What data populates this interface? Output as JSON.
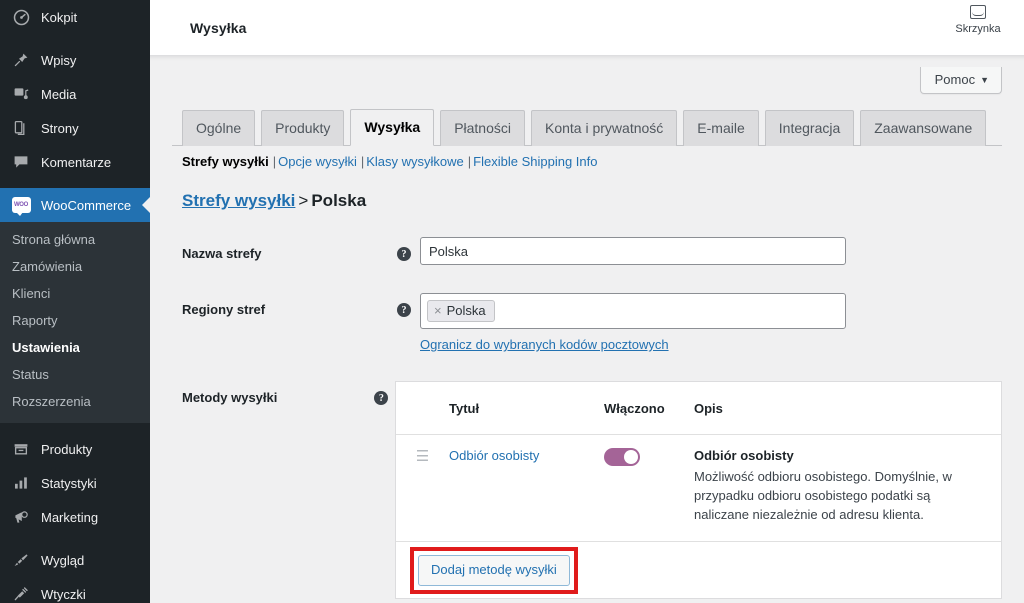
{
  "adminbar": {
    "site_title": "Wysyłka",
    "inbox_label": "Skrzynka",
    "inbox_icon": "inbox-icon"
  },
  "sidebar": {
    "items": [
      {
        "label": "Kokpit",
        "icon": "dashboard-icon",
        "current": false
      },
      {
        "label": "Wpisy",
        "icon": "pin-icon",
        "current": false
      },
      {
        "label": "Media",
        "icon": "media-icon",
        "current": false
      },
      {
        "label": "Strony",
        "icon": "pages-icon",
        "current": false
      },
      {
        "label": "Komentarze",
        "icon": "comment-icon",
        "current": false
      },
      {
        "label": "WooCommerce",
        "icon": "woocommerce-icon",
        "current": true
      },
      {
        "label": "Produkty",
        "icon": "products-box-icon",
        "current": false
      },
      {
        "label": "Statystyki",
        "icon": "bar-chart-icon",
        "current": false
      },
      {
        "label": "Marketing",
        "icon": "megaphone-icon",
        "current": false
      },
      {
        "label": "Wygląd",
        "icon": "paintbrush-icon",
        "current": false
      },
      {
        "label": "Wtyczki",
        "icon": "plug-icon",
        "current": false
      }
    ],
    "woo_submenu": [
      {
        "label": "Strona główna",
        "current": false
      },
      {
        "label": "Zamówienia",
        "current": false
      },
      {
        "label": "Klienci",
        "current": false
      },
      {
        "label": "Raporty",
        "current": false
      },
      {
        "label": "Ustawienia",
        "current": true
      },
      {
        "label": "Status",
        "current": false
      },
      {
        "label": "Rozszerzenia",
        "current": false
      }
    ],
    "woo_badge_text": "WOO"
  },
  "help": {
    "label": "Pomoc",
    "caret": "▼"
  },
  "tabs": [
    {
      "label": "Ogólne",
      "active": false
    },
    {
      "label": "Produkty",
      "active": false
    },
    {
      "label": "Wysyłka",
      "active": true
    },
    {
      "label": "Płatności",
      "active": false
    },
    {
      "label": "Konta i prywatność",
      "active": false
    },
    {
      "label": "E-maile",
      "active": false
    },
    {
      "label": "Integracja",
      "active": false
    },
    {
      "label": "Zaawansowane",
      "active": false
    }
  ],
  "subtabs": [
    {
      "label": "Strefy wysyłki",
      "current": true
    },
    {
      "label": "Opcje wysyłki",
      "current": false
    },
    {
      "label": "Klasy wysyłkowe",
      "current": false
    },
    {
      "label": "Flexible Shipping Info",
      "current": false
    }
  ],
  "breadcrumb": {
    "parent": "Strefy wysyłki",
    "separator": ">",
    "current": "Polska"
  },
  "form": {
    "zone_name": {
      "label": "Nazwa strefy",
      "value": "Polska",
      "placeholder": "Nazwa strefy"
    },
    "zone_regions": {
      "label": "Regiony stref",
      "chip": "Polska",
      "chip_remove": "×",
      "postcode_link": "Ogranicz do wybranych kodów pocztowych"
    },
    "shipping_methods": {
      "label": "Metody wysyłki"
    },
    "help_glyph": "?"
  },
  "methods_table": {
    "columns": [
      "",
      "Tytuł",
      "Włączono",
      "Opis"
    ],
    "rows": [
      {
        "sort_handle": "☰",
        "title": "Odbiór osobisty",
        "enabled": true,
        "desc_title": "Odbiór osobisty",
        "desc_text": "Możliwość odbioru osobistego. Domyślnie, w przypadku odbioru osobistego podatki są naliczane niezależnie od adresu klienta."
      }
    ],
    "add_button": "Dodaj metodę wysyłki"
  },
  "colors": {
    "sidebar_bg": "#1d2327",
    "submenu_bg": "#2c3338",
    "highlight_blue": "#2271b1",
    "toggle_on": "#a46497",
    "annotation_red": "#e01b1b",
    "page_bg": "#f0f0f1"
  }
}
